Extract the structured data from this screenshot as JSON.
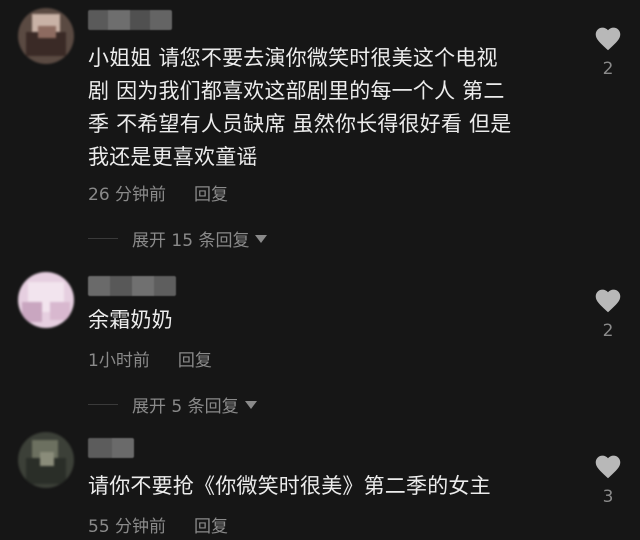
{
  "comments": [
    {
      "avatar": "blurred-avatar",
      "text_lines": [
        "小姐姐 请您不要去演你微笑时很美这个电视",
        "剧 因为我们都喜欢这部剧里的每一个人 第二",
        "季 不希望有人员缺席 虽然你长得很好看 但是",
        "我还是更喜欢童谣"
      ],
      "time": "26 分钟前",
      "reply_label": "回复",
      "like_count": "2",
      "expand_label": "展开 15 条回复"
    },
    {
      "avatar": "blurred-avatar",
      "text_lines": [
        "余霜奶奶"
      ],
      "time": "1小时前",
      "reply_label": "回复",
      "like_count": "2",
      "expand_label": "展开 5 条回复"
    },
    {
      "avatar": "blurred-avatar",
      "text_lines": [
        "请你不要抢《你微笑时很美》第二季的女主"
      ],
      "time": "55 分钟前",
      "reply_label": "回复",
      "like_count": "3"
    }
  ],
  "icons": {
    "like": "heart-icon",
    "expand": "triangle-down-icon"
  },
  "colors": {
    "background": "#161616",
    "text": "#ececec",
    "meta": "#8a8a8a"
  }
}
